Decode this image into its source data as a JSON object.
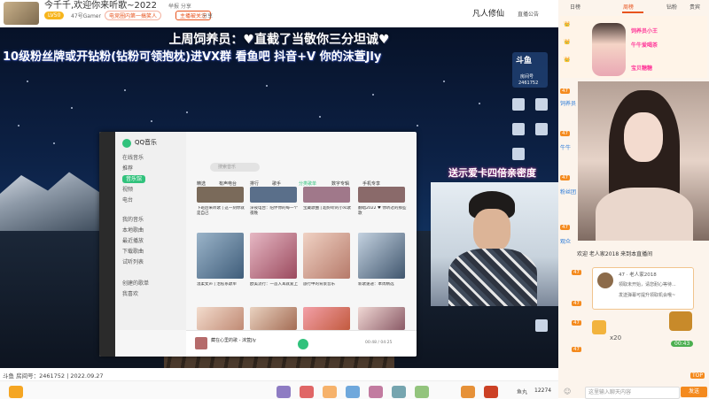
{
  "header": {
    "title": "今千千,欢迎你来听歌~2022",
    "level_badge": "LV50",
    "category": "47号Gamer",
    "rank": "电竞圈内第一搞笑人",
    "follow": "主播被关注",
    "report": "举报  分享",
    "share": "分享",
    "logo": "凡人修仙",
    "notice": "直播公告"
  },
  "video": {
    "overlay_line1": "上周饲养员：♥直截了当敬你三分坦诚♥",
    "overlay_line2": "10级粉丝牌或开钻粉(钻粉可领抱枕)进VX群 看鱼吧 抖音+V 你的沫萱Jly",
    "pink_banner": "送示爱卡四倍亲密度",
    "room_logo": "斗鱼",
    "room_label": "房间号",
    "room_id": "2461752",
    "footer": "斗鱼 房间号：2461752 | 2022.09.27"
  },
  "qq_music": {
    "app_name": "QQ音乐",
    "nav": [
      "在线音乐",
      "推荐",
      "音乐馆",
      "视频",
      "电台",
      "我的音乐",
      "本地歌曲",
      "最近播放",
      "下载歌曲",
      "试听列表",
      "创建的歌单",
      "我喜欢"
    ],
    "search_placeholder": "搜索音乐",
    "tabs": [
      "精选",
      "有声电台",
      "排行",
      "歌手",
      "分类歌单",
      "数字专辑",
      "手机专享"
    ],
    "captions": [
      "下班后来听歌 | 这一刻你就是自己",
      "深夜电台：陪伴你的每一个夜晚",
      "宝藏歌曲 | 超好听的小众歌",
      "翻唱2022 ♥ 你听过的那些歌",
      "温柔女声 | 治愈系歌单",
      "欧美流行：一首入耳就爱上",
      "旅行中的背景音乐",
      "新歌速递：本周精选",
      "抖音热歌 | 循环播放",
      "经典老歌：回忆杀",
      "Chill 轻音乐合集",
      "夜晚安静的时光"
    ],
    "now_playing": "藏在心里的歌 - 沫萱Jly",
    "time": "00:48 / 04:25"
  },
  "gifts": {
    "count_label": "鱼丸",
    "count": "12274"
  },
  "panel": {
    "tabs": [
      "日榜",
      "周榜",
      "钻粉",
      "贵宾"
    ],
    "rank_names": [
      "饲养员小王",
      "牛牛爱喝茶",
      "宝贝糖糖"
    ],
    "side_names": [
      "饲养员",
      "牛牛",
      "粉丝团",
      "观众"
    ],
    "welcome": "欢迎 老人家2018 来到本直播间",
    "popup_title": "47 · 老人家2018",
    "popup_l1": "领取未开始，请您耐心等待...",
    "popup_l2": "发送弹幕可提升领取机会哦~",
    "x20": "x20",
    "chest_time": "00:43",
    "input_placeholder": "这里输入聊天内容",
    "send": "发送",
    "scroll": "TOP"
  }
}
